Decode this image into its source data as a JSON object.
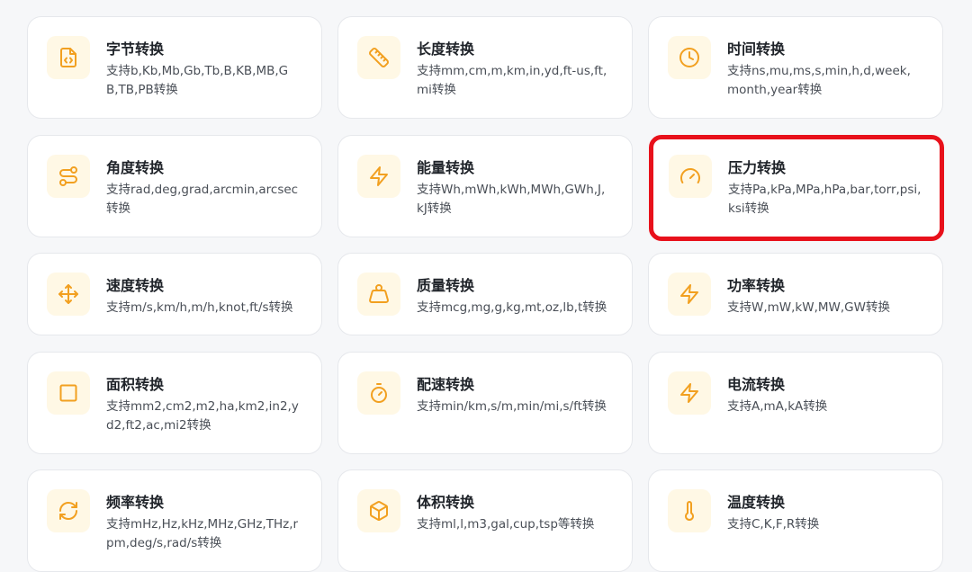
{
  "cards": [
    {
      "title": "字节转换",
      "desc": "支持b,Kb,Mb,Gb,Tb,B,KB,MB,GB,TB,PB转换",
      "icon": "file-code-icon"
    },
    {
      "title": "长度转换",
      "desc": "支持mm,cm,m,km,in,yd,ft-us,ft,mi转换",
      "icon": "ruler-icon"
    },
    {
      "title": "时间转换",
      "desc": "支持ns,mu,ms,s,min,h,d,week,month,year转换",
      "icon": "clock-icon"
    },
    {
      "title": "角度转换",
      "desc": "支持rad,deg,grad,arcmin,arcsec转换",
      "icon": "route-icon"
    },
    {
      "title": "能量转换",
      "desc": "支持Wh,mWh,kWh,MWh,GWh,J,kJ转换",
      "icon": "zap-icon"
    },
    {
      "title": "压力转换",
      "desc": "支持Pa,kPa,MPa,hPa,bar,torr,psi,ksi转换",
      "icon": "gauge-icon"
    },
    {
      "title": "速度转换",
      "desc": "支持m/s,km/h,m/h,knot,ft/s转换",
      "icon": "move-icon"
    },
    {
      "title": "质量转换",
      "desc": "支持mcg,mg,g,kg,mt,oz,lb,t转换",
      "icon": "weight-icon"
    },
    {
      "title": "功率转换",
      "desc": "支持W,mW,kW,MW,GW转换",
      "icon": "zap-icon"
    },
    {
      "title": "面积转换",
      "desc": "支持mm2,cm2,m2,ha,km2,in2,yd2,ft2,ac,mi2转换",
      "icon": "square-icon"
    },
    {
      "title": "配速转换",
      "desc": "支持min/km,s/m,min/mi,s/ft转换",
      "icon": "timer-icon"
    },
    {
      "title": "电流转换",
      "desc": "支持A,mA,kA转换",
      "icon": "zap-icon"
    },
    {
      "title": "频率转换",
      "desc": "支持mHz,Hz,kHz,MHz,GHz,THz,rpm,deg/s,rad/s转换",
      "icon": "refresh-icon"
    },
    {
      "title": "体积转换",
      "desc": "支持ml,l,m3,gal,cup,tsp等转换",
      "icon": "box-icon"
    },
    {
      "title": "温度转换",
      "desc": "支持C,K,F,R转换",
      "icon": "thermometer-icon"
    }
  ],
  "selected_card": "压力转换",
  "colors": {
    "accent": "#f2a020",
    "highlight": "#e8111b",
    "icon_bg": "#fff8e5"
  }
}
